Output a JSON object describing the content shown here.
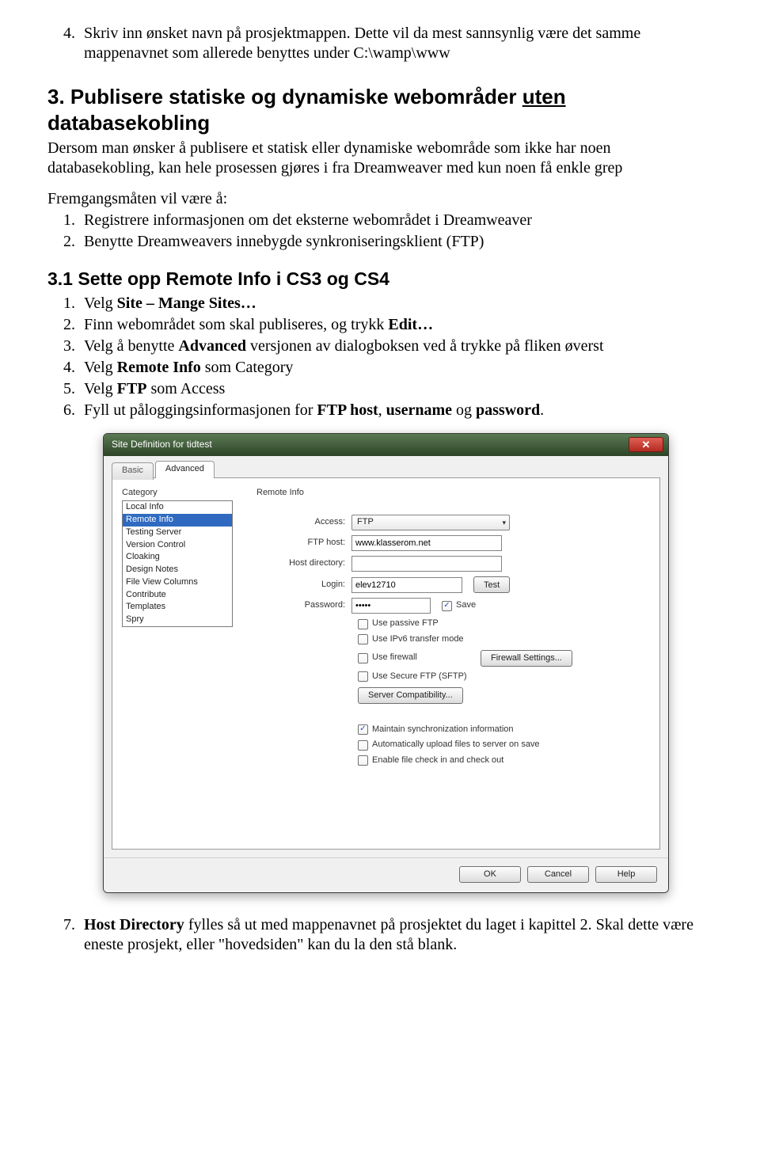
{
  "step4": {
    "num": "4.",
    "text_a": "Skriv inn ønsket navn på prosjektmappen. Dette vil da mest sannsynlig være det samme mappenavnet som allerede benyttes under C:\\wamp\\www"
  },
  "heading3": {
    "prefix": "3. Publisere statiske og dynamiske webområder ",
    "underlined": "uten",
    "suffix": " databasekobling"
  },
  "para_intro": "Dersom man ønsker å publisere et statisk eller dynamiske webområde som ikke har noen databasekobling, kan hele prosessen gjøres i fra Dreamweaver med kun noen få enkle grep",
  "para_frem": "Fremgangsmåten vil være å:",
  "olist_a": [
    "Registrere informasjonen om det eksterne webområdet i Dreamweaver",
    "Benytte Dreamweavers innebygde synkroniseringsklient (FTP)"
  ],
  "heading31": "3.1 Sette opp Remote Info i CS3 og CS4",
  "steps31": [
    {
      "pre": "Velg ",
      "b": "Site – Mange Sites…",
      "post": ""
    },
    {
      "pre": "Finn webområdet som skal publiseres, og trykk ",
      "b": "Edit…",
      "post": ""
    },
    {
      "pre": "Velg å benytte ",
      "b": "Advanced",
      "post": " versjonen av dialogboksen ved å trykke på fliken øverst"
    },
    {
      "pre": "Velg ",
      "b": "Remote Info",
      "post": " som Category"
    },
    {
      "pre": "Velg ",
      "b": "FTP",
      "post": " som Access"
    },
    {
      "pre": "Fyll ut påloggingsinformasjonen for ",
      "b": "FTP host",
      "post": ", ",
      "b2": "username",
      "post2": " og ",
      "b3": "password",
      "post3": "."
    }
  ],
  "dialog": {
    "title": "Site Definition for tidtest",
    "tabs": {
      "basic": "Basic",
      "advanced": "Advanced"
    },
    "category_label": "Category",
    "main_label": "Remote Info",
    "categories": [
      "Local Info",
      "Remote Info",
      "Testing Server",
      "Version Control",
      "Cloaking",
      "Design Notes",
      "File View Columns",
      "Contribute",
      "Templates",
      "Spry"
    ],
    "selected_category_index": 1,
    "fields": {
      "access_label": "Access:",
      "access_value": "FTP",
      "ftphost_label": "FTP host:",
      "ftphost_value": "www.klasserom.net",
      "hostdir_label": "Host directory:",
      "hostdir_value": "",
      "login_label": "Login:",
      "login_value": "elev12710",
      "test_btn": "Test",
      "password_label": "Password:",
      "password_value": "•••••",
      "save_label": "Save",
      "save_checked": true,
      "chk1": "Use passive FTP",
      "chk2": "Use IPv6 transfer mode",
      "chk3": "Use firewall",
      "firewall_btn": "Firewall Settings...",
      "chk4": "Use Secure FTP (SFTP)",
      "servercompat_btn": "Server Compatibility...",
      "chk5": "Maintain synchronization information",
      "chk5_checked": true,
      "chk6": "Automatically upload files to server on save",
      "chk7": "Enable file check in and check out"
    },
    "buttons": {
      "ok": "OK",
      "cancel": "Cancel",
      "help": "Help"
    }
  },
  "step7": {
    "pre": "Host Directory",
    "text": " fylles så ut med mappenavnet på prosjektet du laget i kapittel 2. Skal dette være eneste prosjekt, eller \"hovedsiden\" kan du la den stå blank."
  }
}
